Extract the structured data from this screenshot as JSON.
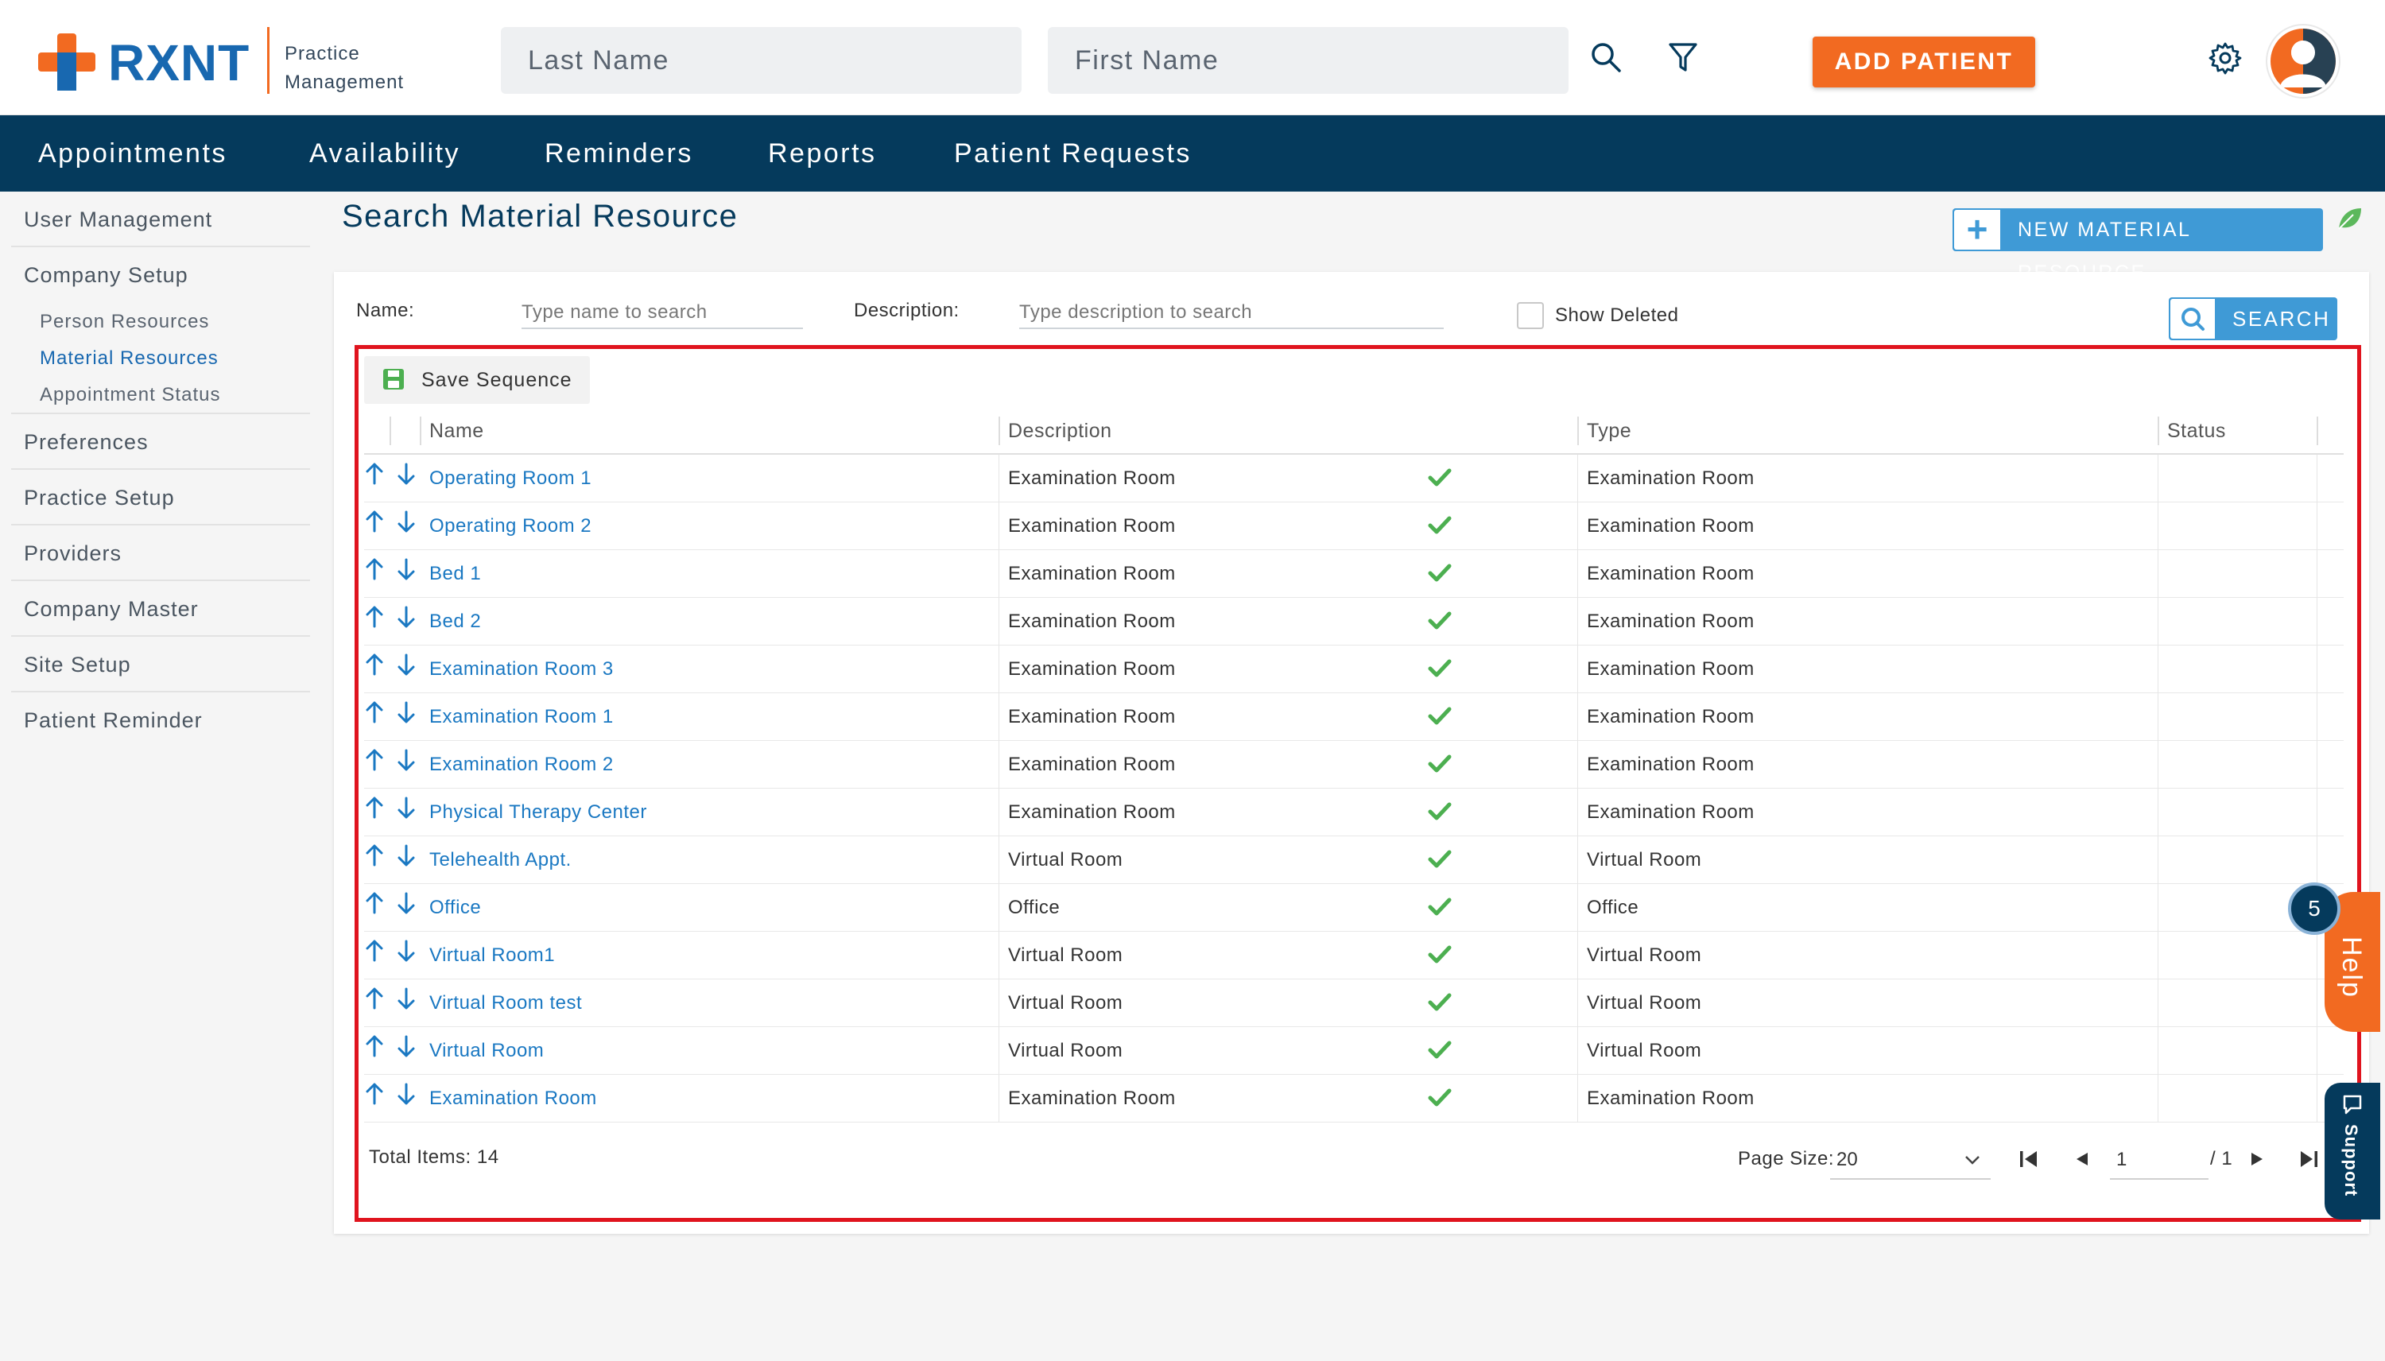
{
  "header": {
    "brand": "RXNT",
    "brand_sub_1": "Practice",
    "brand_sub_2": "Management",
    "last_name_placeholder": "Last Name",
    "first_name_placeholder": "First Name",
    "add_patient_label": "ADD PATIENT",
    "accent_color": "#f26a21",
    "brand_color": "#1868b0"
  },
  "nav": {
    "items": [
      "Appointments",
      "Availability",
      "Reminders",
      "Reports",
      "Patient Requests"
    ],
    "background": "#053a5c"
  },
  "sidebar": {
    "user_management": "User Management",
    "company_setup": "Company Setup",
    "person_resources": "Person Resources",
    "material_resources": "Material Resources",
    "appointment_status": "Appointment Status",
    "preferences": "Preferences",
    "practice_setup": "Practice Setup",
    "providers": "Providers",
    "company_master": "Company Master",
    "site_setup": "Site Setup",
    "patient_reminder": "Patient Reminder"
  },
  "page": {
    "title": "Search Material Resource",
    "new_button_label": "NEW MATERIAL RESOURCE"
  },
  "filters": {
    "name_label": "Name:",
    "name_placeholder": "Type name to search",
    "description_label": "Description:",
    "description_placeholder": "Type description to search",
    "show_deleted_label": "Show Deleted",
    "search_label": "SEARCH"
  },
  "grid": {
    "save_sequence_label": "Save Sequence",
    "columns": [
      "Name",
      "Description",
      "Type",
      "Status"
    ],
    "rows": [
      {
        "name": "Operating Room 1",
        "description": "Examination Room",
        "type": "Examination Room"
      },
      {
        "name": "Operating Room 2",
        "description": "Examination Room",
        "type": "Examination Room"
      },
      {
        "name": "Bed 1",
        "description": "Examination Room",
        "type": "Examination Room"
      },
      {
        "name": "Bed 2",
        "description": "Examination Room",
        "type": "Examination Room"
      },
      {
        "name": "Examination Room 3",
        "description": "Examination Room",
        "type": "Examination Room"
      },
      {
        "name": "Examination Room 1",
        "description": "Examination Room",
        "type": "Examination Room"
      },
      {
        "name": "Examination Room 2",
        "description": "Examination Room",
        "type": "Examination Room"
      },
      {
        "name": "Physical Therapy Center",
        "description": "Examination Room",
        "type": "Examination Room"
      },
      {
        "name": "Telehealth Appt.",
        "description": "Virtual Room",
        "type": "Virtual Room"
      },
      {
        "name": "Office",
        "description": "Office",
        "type": "Office"
      },
      {
        "name": "Virtual Room1",
        "description": "Virtual Room",
        "type": "Virtual Room"
      },
      {
        "name": "Virtual Room test",
        "description": "Virtual Room",
        "type": "Virtual Room"
      },
      {
        "name": "Virtual Room",
        "description": "Virtual Room",
        "type": "Virtual Room"
      },
      {
        "name": "Examination Room",
        "description": "Examination Room",
        "type": "Examination Room"
      }
    ],
    "total_items": "Total Items: 14",
    "page_size_label": "Page Size:",
    "page_size_value": "20",
    "current_page": "1",
    "page_total": "/ 1"
  },
  "widgets": {
    "badge_count": "5",
    "help_label": "Help",
    "support_label": "Support"
  },
  "icons": {
    "search": "search-icon",
    "filter": "filter-icon",
    "settings": "gear-icon",
    "avatar": "user-avatar-icon",
    "status_active": "check-icon",
    "save": "save-icon"
  }
}
